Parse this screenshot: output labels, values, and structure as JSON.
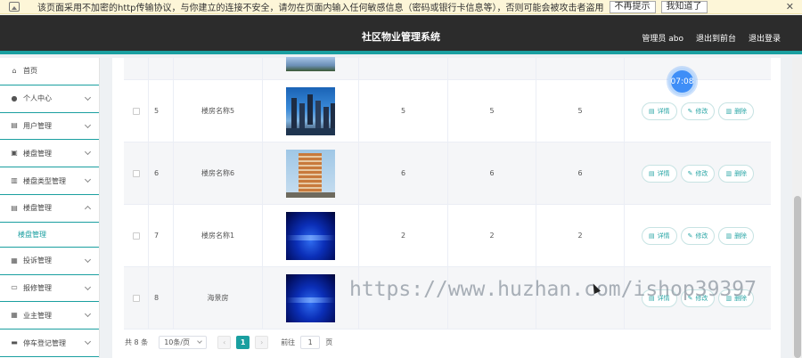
{
  "warning": {
    "text": "该页面采用不加密的http传输协议，与你建立的连接不安全，请勿在页面内输入任何敏感信息（密码或银行卡信息等），否则可能会被攻击者盗用",
    "btn_no_remind": "不再提示",
    "btn_ok": "我知道了",
    "close": "✕"
  },
  "header": {
    "title": "社区物业管理系统",
    "user": "管理员 abo",
    "back_to_front": "退出到前台",
    "logout": "退出登录"
  },
  "sidebar": {
    "items": [
      {
        "label": "首页",
        "icon": "⌂"
      },
      {
        "label": "个人中心",
        "icon": "●"
      },
      {
        "label": "用户管理",
        "icon": "▤"
      },
      {
        "label": "楼盘管理",
        "icon": "▣"
      },
      {
        "label": "楼盘类型管理",
        "icon": "▥"
      },
      {
        "label": "楼盘管理",
        "icon": "▤"
      },
      {
        "label": "投诉管理",
        "icon": "▦"
      },
      {
        "label": "报修管理",
        "icon": "▭"
      },
      {
        "label": "业主管理",
        "icon": "▦"
      },
      {
        "label": "停车登记管理",
        "icon": "▬"
      }
    ],
    "sub_item": "楼盘管理"
  },
  "table": {
    "rows": [
      {
        "index": "5",
        "name": "楼房名称5",
        "v1": "5",
        "v2": "5",
        "v3": "5"
      },
      {
        "index": "6",
        "name": "楼房名称6",
        "v1": "6",
        "v2": "6",
        "v3": "6"
      },
      {
        "index": "7",
        "name": "楼房名称1",
        "v1": "2",
        "v2": "2",
        "v3": "2"
      },
      {
        "index": "8",
        "name": "海景房",
        "v1": "",
        "v2": "",
        "v3": ""
      }
    ],
    "ops": {
      "detail": "详情",
      "edit": "修改",
      "delete": "删除"
    }
  },
  "pagination": {
    "total": "共 8 条",
    "page_size": "10条/页",
    "current_page": "1",
    "goto_label": "前往",
    "goto_value": "1",
    "page_suffix": "页"
  },
  "timer": "07:08",
  "watermark": "https://www.huzhan.com/ishop39397"
}
